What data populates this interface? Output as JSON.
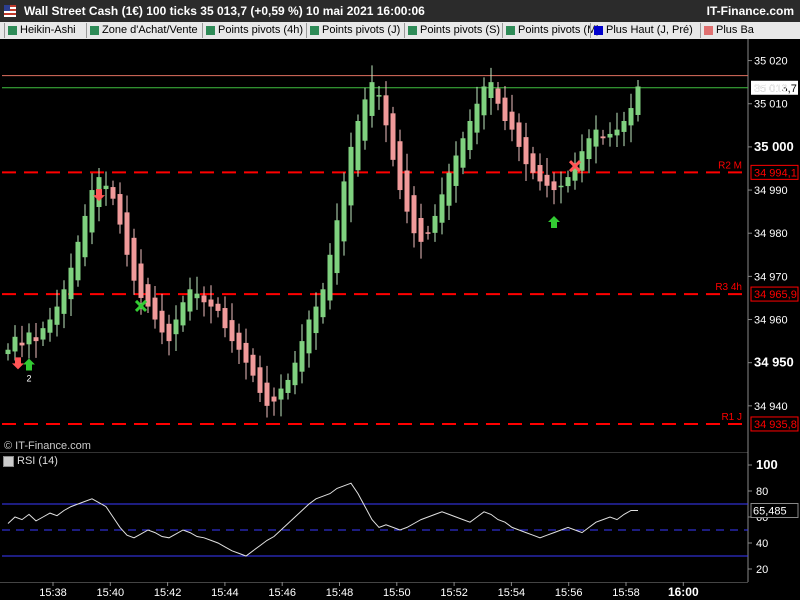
{
  "header": {
    "title": "Wall Street Cash (1€) 100 ticks 35 013,7 (+0,59 %) 10 mai 2021 16:00:06",
    "brand": "IT-Finance.com"
  },
  "toolbar": {
    "items": [
      {
        "label": "Heikin-Ashi",
        "color": "#2e8b57"
      },
      {
        "label": "Zone d'Achat/Vente",
        "color": "#2e8b57"
      },
      {
        "label": "Points pivots (4h)",
        "color": "#2e8b57"
      },
      {
        "label": "Points pivots (J)",
        "color": "#2e8b57"
      },
      {
        "label": "Points pivots (S)",
        "color": "#2e8b57"
      },
      {
        "label": "Points pivots (M)",
        "color": "#2e8b57"
      },
      {
        "label": "Plus Haut (J, Pré)",
        "color": "#0000cc"
      },
      {
        "label": "Plus Ba",
        "color": "#e07070"
      }
    ]
  },
  "colors": {
    "up": "#7fd17f",
    "down": "#f09a9a",
    "pivot": "#ff0000",
    "high_line": "#e07060",
    "low_line": "#40c040",
    "rsi_band": "#3a3aff",
    "rsi_line": "#e0e0e0"
  },
  "watermark": "© IT-Finance.com",
  "chart_data": [
    {
      "type": "candlestick",
      "subtype": "heikin-ashi",
      "title": "Wall Street Cash (1€) 100 ticks",
      "ylim": [
        34930,
        35025
      ],
      "price_ticks": [
        "35 020",
        "35 010",
        "35 000",
        "34 990",
        "34 980",
        "34 970",
        "34 960",
        "34 950",
        "34 940"
      ],
      "price_tick_values": [
        35020,
        35010,
        35000,
        34990,
        34980,
        34970,
        34960,
        34950,
        34940
      ],
      "time_labels": [
        "15:38",
        "15:40",
        "15:42",
        "15:44",
        "15:46",
        "15:48",
        "15:50",
        "15:52",
        "15:54",
        "15:56",
        "15:58",
        "16:00"
      ],
      "close_path": [
        34953,
        34956,
        34954,
        34957,
        34955,
        34958,
        34960,
        34963,
        34967,
        34972,
        34978,
        34984,
        34990,
        34993,
        34991,
        34988,
        34982,
        34975,
        34969,
        34965,
        34963,
        34960,
        34957,
        34955,
        34960,
        34964,
        34967,
        34966,
        34964,
        34963,
        34962,
        34958,
        34955,
        34953,
        34950,
        34947,
        34943,
        34940,
        34941,
        34944,
        34946,
        34950,
        34955,
        34960,
        34963,
        34967,
        34975,
        34983,
        34992,
        35000,
        35006,
        35011,
        35015,
        35012,
        35005,
        34997,
        34990,
        34985,
        34980,
        34978,
        34980,
        34984,
        34989,
        34994,
        34998,
        35002,
        35006,
        35010,
        35014,
        35015,
        35010,
        35006,
        35004,
        35000,
        34996,
        34994,
        34992,
        34991,
        34990,
        34991,
        34993,
        34996,
        34999,
        35002,
        35004,
        35002,
        35003,
        35004,
        35006,
        35009,
        35014
      ],
      "price_labels": [
        {
          "text": "35 013,7",
          "value": 35013.7,
          "color": "#000000",
          "background": "#ffffff"
        },
        {
          "text": "35 012",
          "value": 35012,
          "color": "#ffffff",
          "background": ""
        },
        {
          "text": "35 020",
          "value": 35020,
          "color": "#ffffff",
          "background": ""
        },
        {
          "text": "35 010",
          "value": 35010,
          "color": "#ffffff",
          "background": ""
        }
      ],
      "levels": [
        {
          "name": "R2 M",
          "value": 34994.1,
          "label": "34 994,1",
          "color": "#ff0000",
          "style": "dashed"
        },
        {
          "name": "R3 4h",
          "value": 34965.9,
          "label": "34 965,9",
          "color": "#ff0000",
          "style": "dashed"
        },
        {
          "name": "R1 J",
          "value": 34935.8,
          "label": "34 935,8",
          "color": "#ff0000",
          "style": "dashed"
        },
        {
          "name": "",
          "value": 35016.5,
          "label": "",
          "color": "#e07060",
          "style": "solid"
        },
        {
          "name": "",
          "value": 35013.7,
          "label": "",
          "color": "#40c040",
          "style": "solid"
        }
      ],
      "signals": [
        {
          "type": "buy-arrow",
          "index": 3,
          "label": "2"
        },
        {
          "type": "sell-arrow",
          "index": 13,
          "label": ""
        },
        {
          "type": "exit-cross-green",
          "index": 19,
          "label": ""
        },
        {
          "type": "buy-arrow",
          "index": 78,
          "label": ""
        },
        {
          "type": "exit-cross-red",
          "index": 81,
          "label": ""
        }
      ]
    },
    {
      "type": "line",
      "title": "RSI (14)",
      "ylim": [
        10,
        110
      ],
      "ticks": [
        100,
        80,
        60,
        40,
        20
      ],
      "bands": [
        70,
        50,
        30
      ],
      "current_label": "65,485",
      "values": [
        55,
        60,
        58,
        62,
        57,
        60,
        63,
        61,
        65,
        68,
        70,
        72,
        74,
        71,
        68,
        60,
        52,
        46,
        44,
        47,
        50,
        48,
        45,
        44,
        47,
        50,
        48,
        45,
        44,
        42,
        40,
        37,
        34,
        32,
        30,
        34,
        38,
        42,
        45,
        50,
        55,
        60,
        65,
        70,
        74,
        76,
        78,
        82,
        84,
        86,
        78,
        68,
        58,
        52,
        54,
        52,
        50,
        52,
        55,
        58,
        60,
        62,
        64,
        62,
        60,
        58,
        56,
        60,
        64,
        62,
        58,
        56,
        52,
        50,
        48,
        46,
        44,
        46,
        48,
        50,
        52,
        50,
        48,
        52,
        56,
        58,
        60,
        58,
        62,
        65,
        65
      ]
    }
  ]
}
